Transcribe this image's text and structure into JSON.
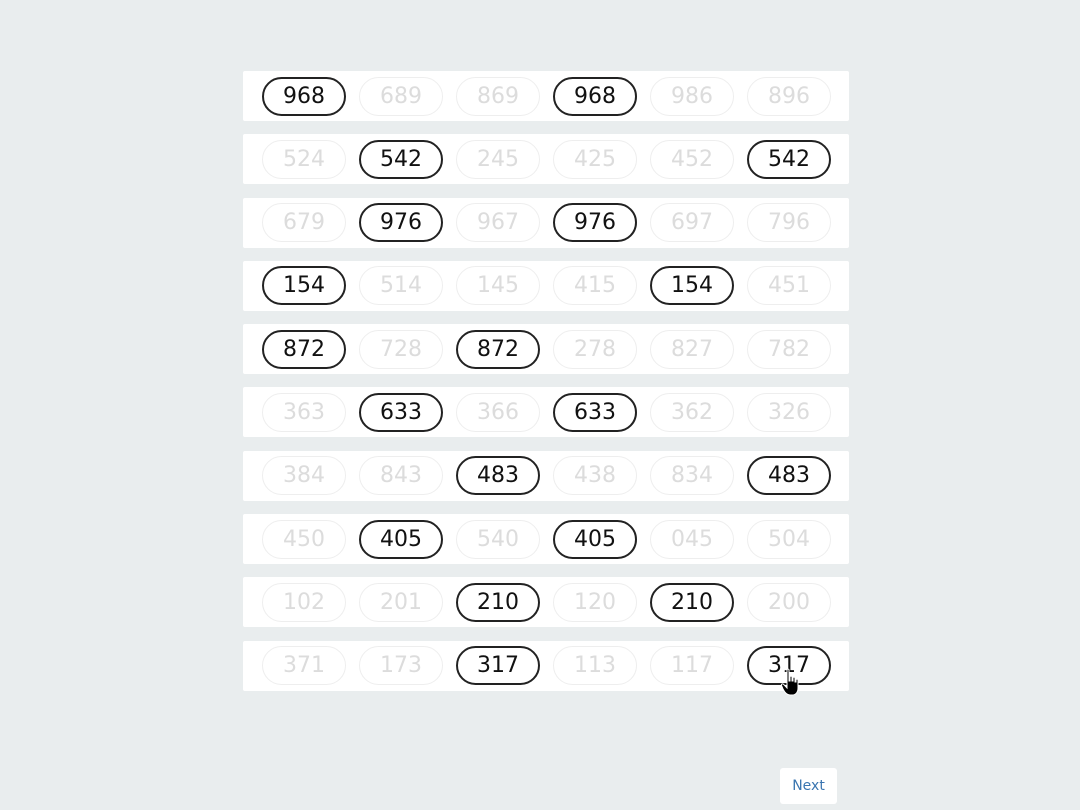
{
  "rows": [
    {
      "cells": [
        {
          "v": "968",
          "sel": true
        },
        {
          "v": "689",
          "sel": false
        },
        {
          "v": "869",
          "sel": false
        },
        {
          "v": "968",
          "sel": true
        },
        {
          "v": "986",
          "sel": false
        },
        {
          "v": "896",
          "sel": false
        }
      ]
    },
    {
      "cells": [
        {
          "v": "524",
          "sel": false
        },
        {
          "v": "542",
          "sel": true
        },
        {
          "v": "245",
          "sel": false
        },
        {
          "v": "425",
          "sel": false
        },
        {
          "v": "452",
          "sel": false
        },
        {
          "v": "542",
          "sel": true
        }
      ]
    },
    {
      "cells": [
        {
          "v": "679",
          "sel": false
        },
        {
          "v": "976",
          "sel": true
        },
        {
          "v": "967",
          "sel": false
        },
        {
          "v": "976",
          "sel": true
        },
        {
          "v": "697",
          "sel": false
        },
        {
          "v": "796",
          "sel": false
        }
      ]
    },
    {
      "cells": [
        {
          "v": "154",
          "sel": true
        },
        {
          "v": "514",
          "sel": false
        },
        {
          "v": "145",
          "sel": false
        },
        {
          "v": "415",
          "sel": false
        },
        {
          "v": "154",
          "sel": true
        },
        {
          "v": "451",
          "sel": false
        }
      ]
    },
    {
      "cells": [
        {
          "v": "872",
          "sel": true
        },
        {
          "v": "728",
          "sel": false
        },
        {
          "v": "872",
          "sel": true
        },
        {
          "v": "278",
          "sel": false
        },
        {
          "v": "827",
          "sel": false
        },
        {
          "v": "782",
          "sel": false
        }
      ]
    },
    {
      "cells": [
        {
          "v": "363",
          "sel": false
        },
        {
          "v": "633",
          "sel": true
        },
        {
          "v": "366",
          "sel": false
        },
        {
          "v": "633",
          "sel": true
        },
        {
          "v": "362",
          "sel": false
        },
        {
          "v": "326",
          "sel": false
        }
      ]
    },
    {
      "cells": [
        {
          "v": "384",
          "sel": false
        },
        {
          "v": "843",
          "sel": false
        },
        {
          "v": "483",
          "sel": true
        },
        {
          "v": "438",
          "sel": false
        },
        {
          "v": "834",
          "sel": false
        },
        {
          "v": "483",
          "sel": true
        }
      ]
    },
    {
      "cells": [
        {
          "v": "450",
          "sel": false
        },
        {
          "v": "405",
          "sel": true
        },
        {
          "v": "540",
          "sel": false
        },
        {
          "v": "405",
          "sel": true
        },
        {
          "v": "045",
          "sel": false
        },
        {
          "v": "504",
          "sel": false
        }
      ]
    },
    {
      "cells": [
        {
          "v": "102",
          "sel": false
        },
        {
          "v": "201",
          "sel": false
        },
        {
          "v": "210",
          "sel": true
        },
        {
          "v": "120",
          "sel": false
        },
        {
          "v": "210",
          "sel": true
        },
        {
          "v": "200",
          "sel": false
        }
      ]
    },
    {
      "cells": [
        {
          "v": "371",
          "sel": false
        },
        {
          "v": "173",
          "sel": false
        },
        {
          "v": "317",
          "sel": true
        },
        {
          "v": "113",
          "sel": false
        },
        {
          "v": "117",
          "sel": false
        },
        {
          "v": "317",
          "sel": true
        }
      ]
    }
  ],
  "next_label": "Next",
  "colors": {
    "background": "#e9edee",
    "selected_border": "#222222",
    "dim_text": "#dcdcdc",
    "link": "#3a75b0"
  },
  "icons": {
    "cursor": "hand-pointer-icon"
  }
}
